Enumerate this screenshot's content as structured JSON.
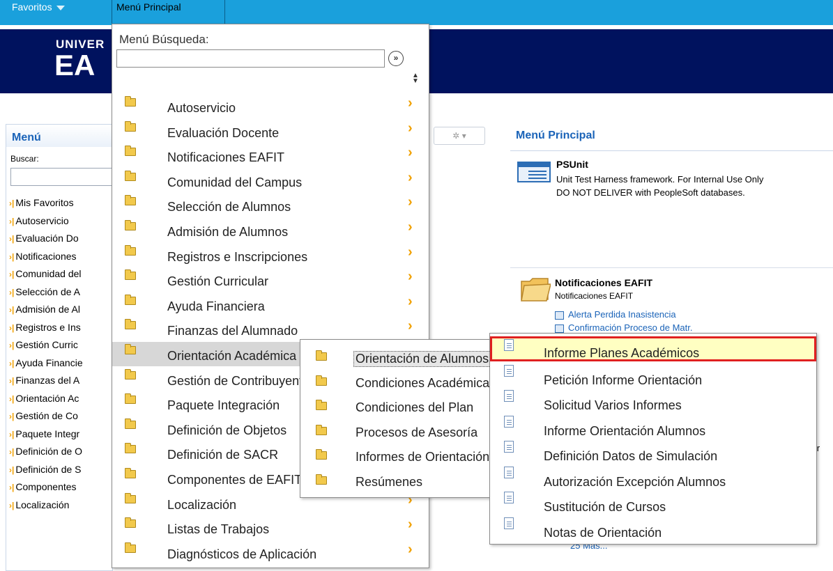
{
  "topbar": {
    "favoritos": "Favoritos",
    "menu_principal": "Menú Principal"
  },
  "banner": {
    "logo_line1": "UNIVER",
    "logo_line2": "EA"
  },
  "left_panel": {
    "title": "Menú",
    "search_label": "Buscar:",
    "items": [
      "Mis Favoritos",
      "Autoservicio",
      "Evaluación Do",
      "Notificaciones",
      "Comunidad del",
      "Selección de A",
      "Admisión de Al",
      "Registros e Ins",
      "Gestión Curric",
      "Ayuda Financie",
      "Finanzas del A",
      "Orientación Ac",
      "Gestión de Co",
      "Paquete Integr",
      "Definición de O",
      "Definición de S",
      "Componentes",
      "Localización"
    ]
  },
  "right_panel": {
    "title": "Menú Principal",
    "psunit": {
      "title": "PSUnit",
      "desc_line1": "Unit Test Harness framework. For Internal Use Only",
      "desc_line2": "DO NOT DELIVER with PeopleSoft databases."
    },
    "notificaciones": {
      "title": "Notificaciones EAFIT",
      "subtitle": "Notificaciones EAFIT",
      "links": [
        "Alerta Perdida Inasistencia",
        "Confirmación Proceso de Matr."
      ]
    },
    "fragment_sar": "sar",
    "fragment_mas": "25 Más..."
  },
  "dropdown_menu": {
    "search_label": "Menú Búsqueda:",
    "search_value": "",
    "go_symbol": "»",
    "items": [
      "Autoservicio",
      "Evaluación Docente",
      "Notificaciones EAFIT",
      "Comunidad del Campus",
      "Selección de Alumnos",
      "Admisión de Alumnos",
      "Registros e Inscripciones",
      "Gestión Curricular",
      "Ayuda Financiera",
      "Finanzas del Alumnado",
      "Orientación Académica",
      "Gestión de Contribuyentes",
      "Paquete Integración",
      "Definición de Objetos",
      "Definición de SACR",
      "Componentes de EAFIT",
      "Localización",
      "Listas de Trabajos",
      "Diagnósticos de Aplicación"
    ],
    "selected_index": 10
  },
  "submenu_orientacion": {
    "items": [
      "Orientación de Alumnos",
      "Condiciones Académicas",
      "Condiciones del Plan",
      "Procesos de Asesoría",
      "Informes de Orientación",
      "Resúmenes"
    ],
    "selected_index": 0
  },
  "submenu_informes": {
    "items": [
      "Informe Planes Académicos",
      "Petición Informe Orientación",
      "Solicitud Varios Informes",
      "Informe Orientación Alumnos",
      "Definición Datos de Simulación",
      "Autorización Excepción Alumnos",
      "Sustitución de Cursos",
      "Notas de Orientación"
    ],
    "highlighted_index": 0,
    "highlight_color": "#e02020"
  }
}
